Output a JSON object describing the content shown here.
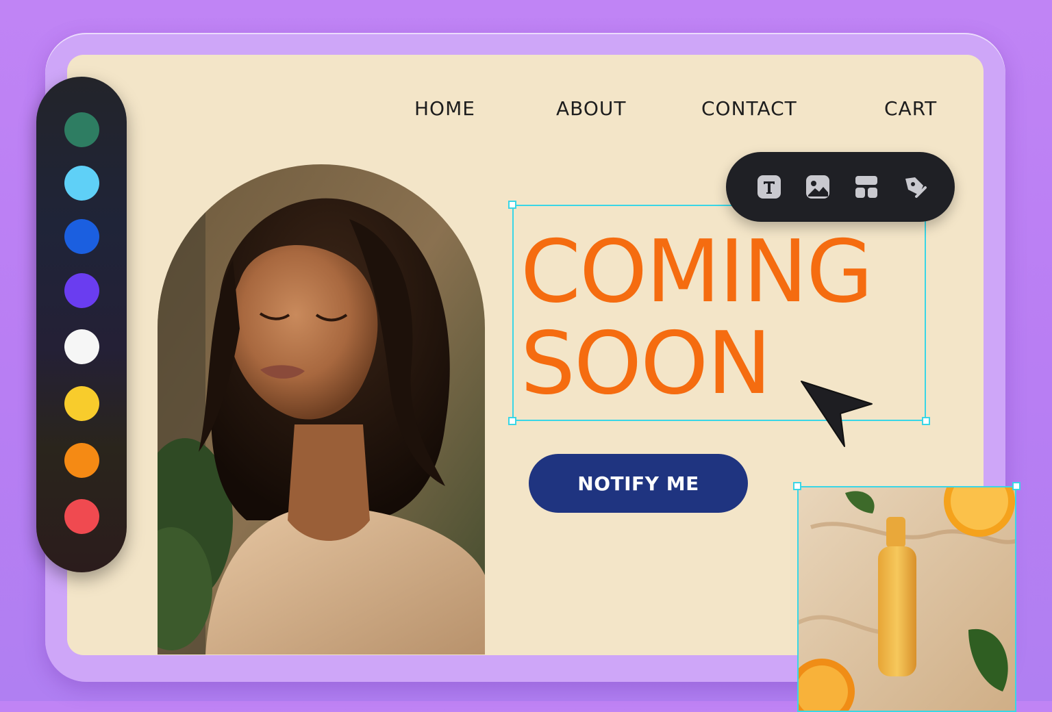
{
  "nav": {
    "items": [
      {
        "label": "HOME"
      },
      {
        "label": "ABOUT"
      },
      {
        "label": "CONTACT"
      },
      {
        "label": "CART"
      }
    ]
  },
  "hero": {
    "headline_line1": "COMING",
    "headline_line2": "SOON",
    "cta_label": "NOTIFY ME"
  },
  "palette": {
    "swatches": [
      "#2e7d62",
      "#5fd0f7",
      "#1b5fe0",
      "#6a3df0",
      "#f6f6f6",
      "#f8cc2c",
      "#f58a14",
      "#f04a50"
    ]
  },
  "toolbar": {
    "tools": [
      "text-icon",
      "image-icon",
      "layout-icon",
      "pen-icon"
    ]
  },
  "colors": {
    "background": "#c084f5",
    "page": "#f3e5c8",
    "headline": "#f56c10",
    "cta": "#1f3480",
    "selection": "#39d6e6"
  }
}
